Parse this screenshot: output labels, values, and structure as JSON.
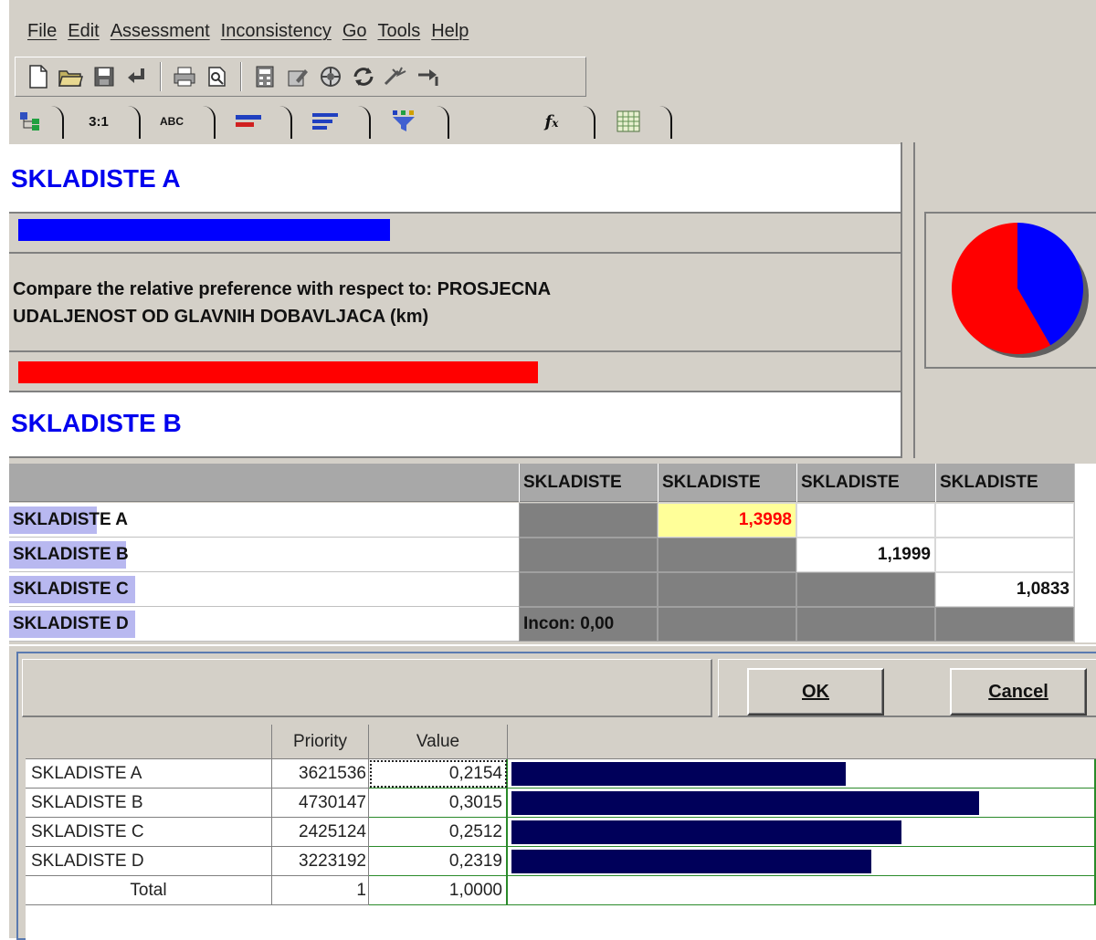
{
  "menu": {
    "items": [
      "File",
      "Edit",
      "Assessment",
      "Inconsistency",
      "Go",
      "Tools",
      "Help"
    ]
  },
  "toolbar": {
    "icons": [
      "new-file-icon",
      "open-folder-icon",
      "save-icon",
      "undo-icon",
      "print-icon",
      "print-preview-icon",
      "calculator-icon",
      "edit-icon",
      "network-icon",
      "refresh-icon",
      "tools-icon",
      "arrow-icon"
    ]
  },
  "tabs": {
    "tab1_icon": "tree-icon",
    "tab2_label": "3:1",
    "tab3_label": "ABC",
    "tab4_icon": "bars-icon",
    "tab5_icon": "list-icon",
    "tab6_icon": "funnel-icon",
    "tab7_icon": "fx-icon",
    "tab8_icon": "grid-icon"
  },
  "compare": {
    "item_a": "SKLADISTE A",
    "item_b": "SKLADISTE B",
    "text_line1": "Compare the relative preference with respect to: PROSJECNA",
    "text_line2": "UDALJENOST OD GLAVNIH DOBAVLJACA (km)",
    "bar_a_fraction": 0.4166,
    "bar_b_fraction": 0.5834,
    "color_a": "#0000ff",
    "color_b": "#ff0000"
  },
  "matrix": {
    "column_headers": [
      "SKLADISTE",
      "SKLADISTE",
      "SKLADISTE",
      "SKLADISTE"
    ],
    "rows": [
      {
        "label": "SKLADISTE A",
        "cells": [
          "",
          "1,3998",
          "",
          ""
        ]
      },
      {
        "label": "SKLADISTE B",
        "cells": [
          "",
          "",
          "1,1999",
          ""
        ]
      },
      {
        "label": "SKLADISTE C",
        "cells": [
          "",
          "",
          "",
          "1,0833"
        ]
      },
      {
        "label": "SKLADISTE D",
        "cells": [
          "Incon: 0,00",
          "",
          "",
          ""
        ]
      }
    ]
  },
  "dialog": {
    "ok_label": "OK",
    "cancel_label": "Cancel",
    "col_priority": "Priority",
    "col_value": "Value",
    "rows": [
      {
        "name": "SKLADISTE A",
        "priority": "3621536",
        "value": "0,2154",
        "fraction": 0.2154
      },
      {
        "name": "SKLADISTE B",
        "priority": "4730147",
        "value": "0,3015",
        "fraction": 0.3015
      },
      {
        "name": "SKLADISTE C",
        "priority": "2425124",
        "value": "0,2512",
        "fraction": 0.2512
      },
      {
        "name": "SKLADISTE D",
        "priority": "3223192",
        "value": "0,2319",
        "fraction": 0.2319
      }
    ],
    "total": {
      "name": "Total",
      "priority": "1",
      "value": "1,0000"
    }
  }
}
